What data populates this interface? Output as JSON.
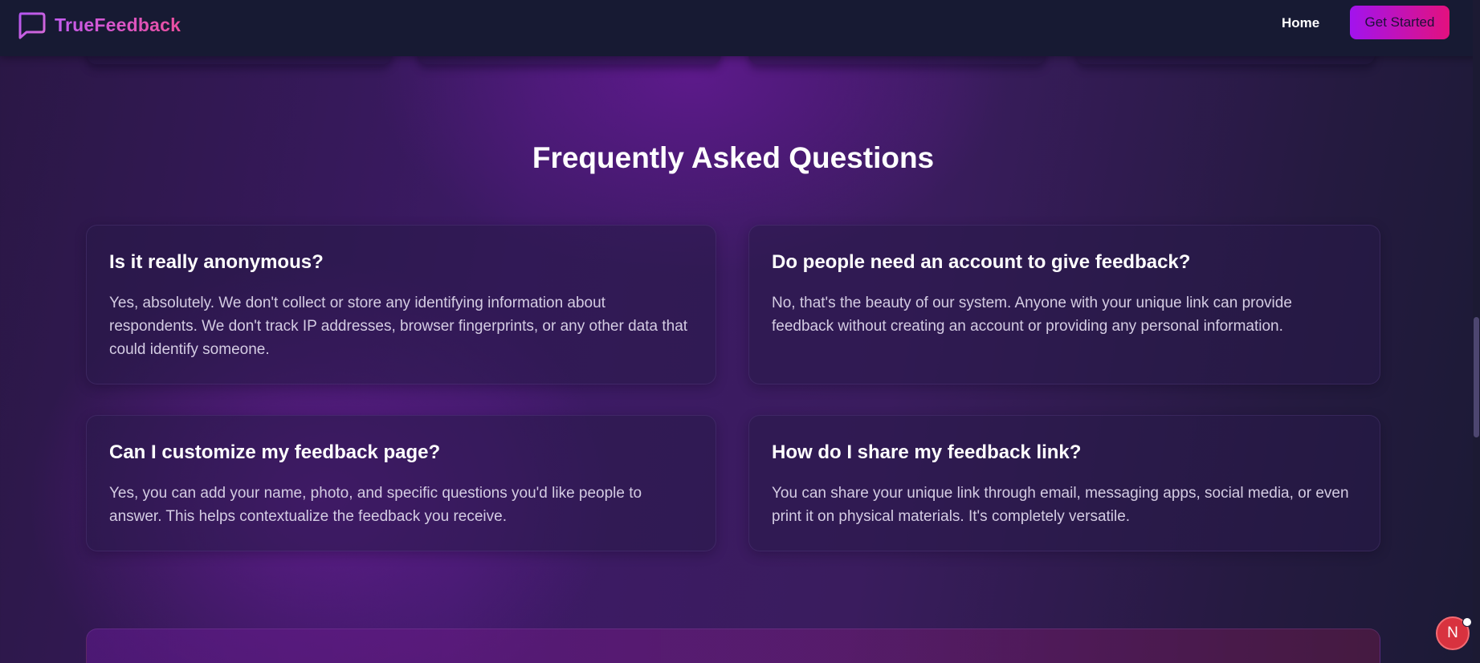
{
  "navbar": {
    "brand_name": "TrueFeedback",
    "brand_icon": "chat-bubble-icon",
    "home_label": "Home",
    "cta_label": "Get Started"
  },
  "faq": {
    "title": "Frequently Asked Questions",
    "items": [
      {
        "question": "Is it really anonymous?",
        "answer": "Yes, absolutely. We don't collect or store any identifying information about respondents. We don't track IP addresses, browser fingerprints, or any other data that could identify someone."
      },
      {
        "question": "Do people need an account to give feedback?",
        "answer": "No, that's the beauty of our system. Anyone with your unique link can provide feedback without creating an account or providing any personal information."
      },
      {
        "question": "Can I customize my feedback page?",
        "answer": "Yes, you can add your name, photo, and specific questions you'd like people to answer. This helps contextualize the feedback you receive."
      },
      {
        "question": "How do I share my feedback link?",
        "answer": "You can share your unique link through email, messaging apps, social media, or even print it on physical materials. It's completely versatile."
      }
    ]
  },
  "dev_indicator": {
    "label": "N"
  },
  "colors": {
    "background_dark": "#171a33",
    "accent_purple": "#a213ee",
    "accent_pink": "#e3117e",
    "brand_gradient_start": "#c45cf0",
    "brand_gradient_end": "#ec4f9f",
    "answer_text": "#d4cce3",
    "dev_badge": "#d8323f"
  }
}
